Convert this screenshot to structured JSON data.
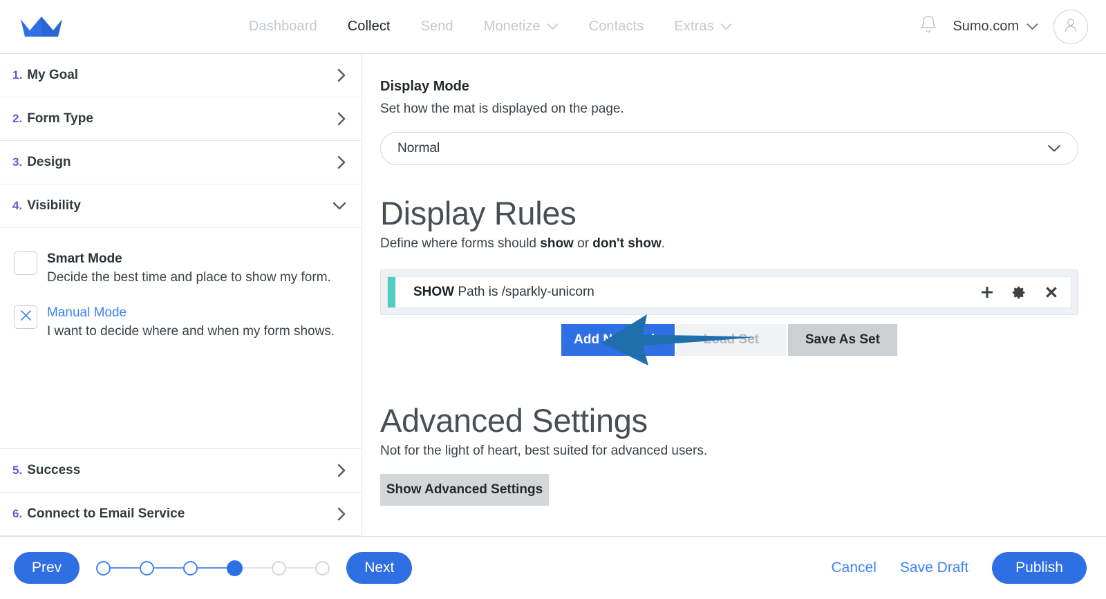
{
  "header": {
    "logo_icon": "crown-icon",
    "nav": [
      {
        "label": "Dashboard",
        "active": false,
        "has_dropdown": false
      },
      {
        "label": "Collect",
        "active": true,
        "has_dropdown": false
      },
      {
        "label": "Send",
        "active": false,
        "has_dropdown": false
      },
      {
        "label": "Monetize",
        "active": false,
        "has_dropdown": true
      },
      {
        "label": "Contacts",
        "active": false,
        "has_dropdown": false
      },
      {
        "label": "Extras",
        "active": false,
        "has_dropdown": true
      }
    ],
    "notifications_icon": "bell-icon",
    "account_label": "Sumo.com",
    "account_chevron_icon": "chevron-down-icon",
    "avatar_icon": "user-avatar-icon"
  },
  "sidebar": {
    "steps": [
      {
        "num": "1.",
        "label": "My Goal",
        "expanded": false
      },
      {
        "num": "2.",
        "label": "Form Type",
        "expanded": false
      },
      {
        "num": "3.",
        "label": "Design",
        "expanded": false
      },
      {
        "num": "4.",
        "label": "Visibility",
        "expanded": true
      },
      {
        "num": "5.",
        "label": "Success",
        "expanded": false
      },
      {
        "num": "6.",
        "label": "Connect to Email Service",
        "expanded": false
      }
    ],
    "visibility": {
      "modes": [
        {
          "title": "Smart Mode",
          "desc": "Decide the best time and place to show my form.",
          "checked": false
        },
        {
          "title": "Manual Mode",
          "desc": "I want to decide where and when my form shows.",
          "checked": true
        }
      ]
    }
  },
  "main": {
    "display_mode": {
      "title": "Display Mode",
      "subtitle": "Set how the mat is displayed on the page.",
      "selected": "Normal",
      "options": [
        "Normal"
      ],
      "chevron_icon": "chevron-down-icon"
    },
    "display_rules": {
      "heading": "Display Rules",
      "sub_prefix": "Define where forms should ",
      "sub_bold1": "show",
      "sub_mid": " or ",
      "sub_bold2": "don't show",
      "sub_suffix": ".",
      "rules": [
        {
          "action": "SHOW",
          "condition": "Path is /sparkly-unicorn",
          "accent_color": "#4ECDC4",
          "add_icon": "plus-icon",
          "settings_icon": "gear-icon",
          "remove_icon": "close-icon"
        }
      ],
      "buttons": {
        "add": "Add New Rule",
        "load": "Load Set",
        "save": "Save As Set"
      }
    },
    "advanced": {
      "heading": "Advanced Settings",
      "subtitle": "Not for the light of heart, best suited for advanced users.",
      "button": "Show Advanced Settings"
    }
  },
  "footer": {
    "prev": "Prev",
    "next": "Next",
    "cancel": "Cancel",
    "save_draft": "Save Draft",
    "publish": "Publish",
    "stepper": {
      "total": 6,
      "current": 4
    }
  },
  "annotation": {
    "arrow_icon": "left-arrow-annotation",
    "color": "#1f6fad"
  },
  "colors": {
    "accent_blue": "#2f6fe4",
    "link_blue": "#3b82f6",
    "step_number": "#5b5fd6",
    "rule_accent": "#4ECDC4",
    "annotation": "#1f6fad"
  }
}
